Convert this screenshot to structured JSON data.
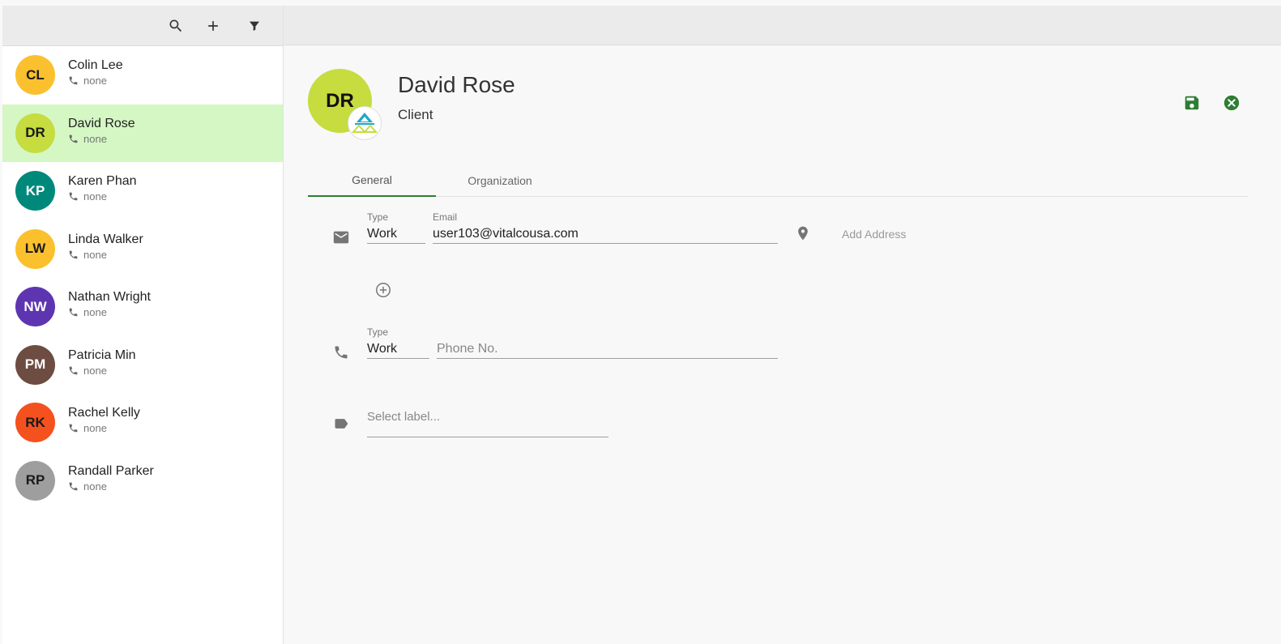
{
  "sidebar": {
    "contacts": [
      {
        "initials": "CL",
        "name": "Colin Lee",
        "phone": "none",
        "color": "#fbc02d",
        "dark_text": true
      },
      {
        "initials": "DR",
        "name": "David Rose",
        "phone": "none",
        "color": "#c6dc3f",
        "dark_text": true
      },
      {
        "initials": "KP",
        "name": "Karen Phan",
        "phone": "none",
        "color": "#00897b",
        "dark_text": false
      },
      {
        "initials": "LW",
        "name": "Linda Walker",
        "phone": "none",
        "color": "#fbc02d",
        "dark_text": true
      },
      {
        "initials": "NW",
        "name": "Nathan Wright",
        "phone": "none",
        "color": "#5e35b1",
        "dark_text": false
      },
      {
        "initials": "PM",
        "name": "Patricia Min",
        "phone": "none",
        "color": "#6d4c41",
        "dark_text": false
      },
      {
        "initials": "RK",
        "name": "Rachel Kelly",
        "phone": "none",
        "color": "#f4511e",
        "dark_text": true
      },
      {
        "initials": "RP",
        "name": "Randall Parker",
        "phone": "none",
        "color": "#9e9e9e",
        "dark_text": true
      }
    ],
    "selected_index": 1
  },
  "detail": {
    "initials": "DR",
    "name": "David Rose",
    "role": "Client",
    "tabs": [
      {
        "label": "General"
      },
      {
        "label": "Organization"
      }
    ],
    "email": {
      "type_label": "Type",
      "type_value": "Work",
      "email_label": "Email",
      "email_value": "user103@vitalcousa.com"
    },
    "add_address": "Add Address",
    "phone": {
      "type_label": "Type",
      "type_value": "Work",
      "placeholder": "Phone No."
    },
    "label_placeholder": "Select label..."
  },
  "colors": {
    "accent": "#2e7d32",
    "selected_row": "#d4f7c4"
  }
}
